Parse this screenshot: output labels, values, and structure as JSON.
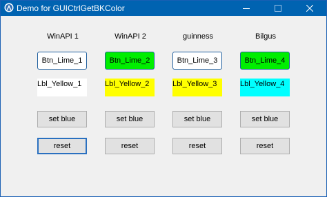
{
  "window": {
    "title": "Demo for GUICtrlGetBKColor",
    "accent": "#0063b1"
  },
  "columns": [
    {
      "header": "WinAPI 1",
      "button": "Btn_Lime_1",
      "label": "Lbl_Yellow_1",
      "label_bg": "#ffffff",
      "button_bg": "#ffffff",
      "set_blue": "set blue",
      "reset": "reset"
    },
    {
      "header": "WinAPI 2",
      "button": "Btn_Lime_2",
      "label": "Lbl_Yellow_2",
      "label_bg": "#ffff00",
      "button_bg": "#00ee00",
      "set_blue": "set blue",
      "reset": "reset"
    },
    {
      "header": "guinness",
      "button": "Btn_Lime_3",
      "label": "Lbl_Yellow_3",
      "label_bg": "#ffff00",
      "button_bg": "#ffffff",
      "set_blue": "set blue",
      "reset": "reset"
    },
    {
      "header": "Bilgus",
      "button": "Btn_Lime_4",
      "label": "Lbl_Yellow_4",
      "label_bg": "#00ffff",
      "button_bg": "#00ee00",
      "set_blue": "set blue",
      "reset": "reset"
    }
  ],
  "icons": {
    "app": "autoit-icon",
    "minimize": "minimize-icon",
    "maximize": "maximize-icon",
    "close": "close-icon"
  }
}
